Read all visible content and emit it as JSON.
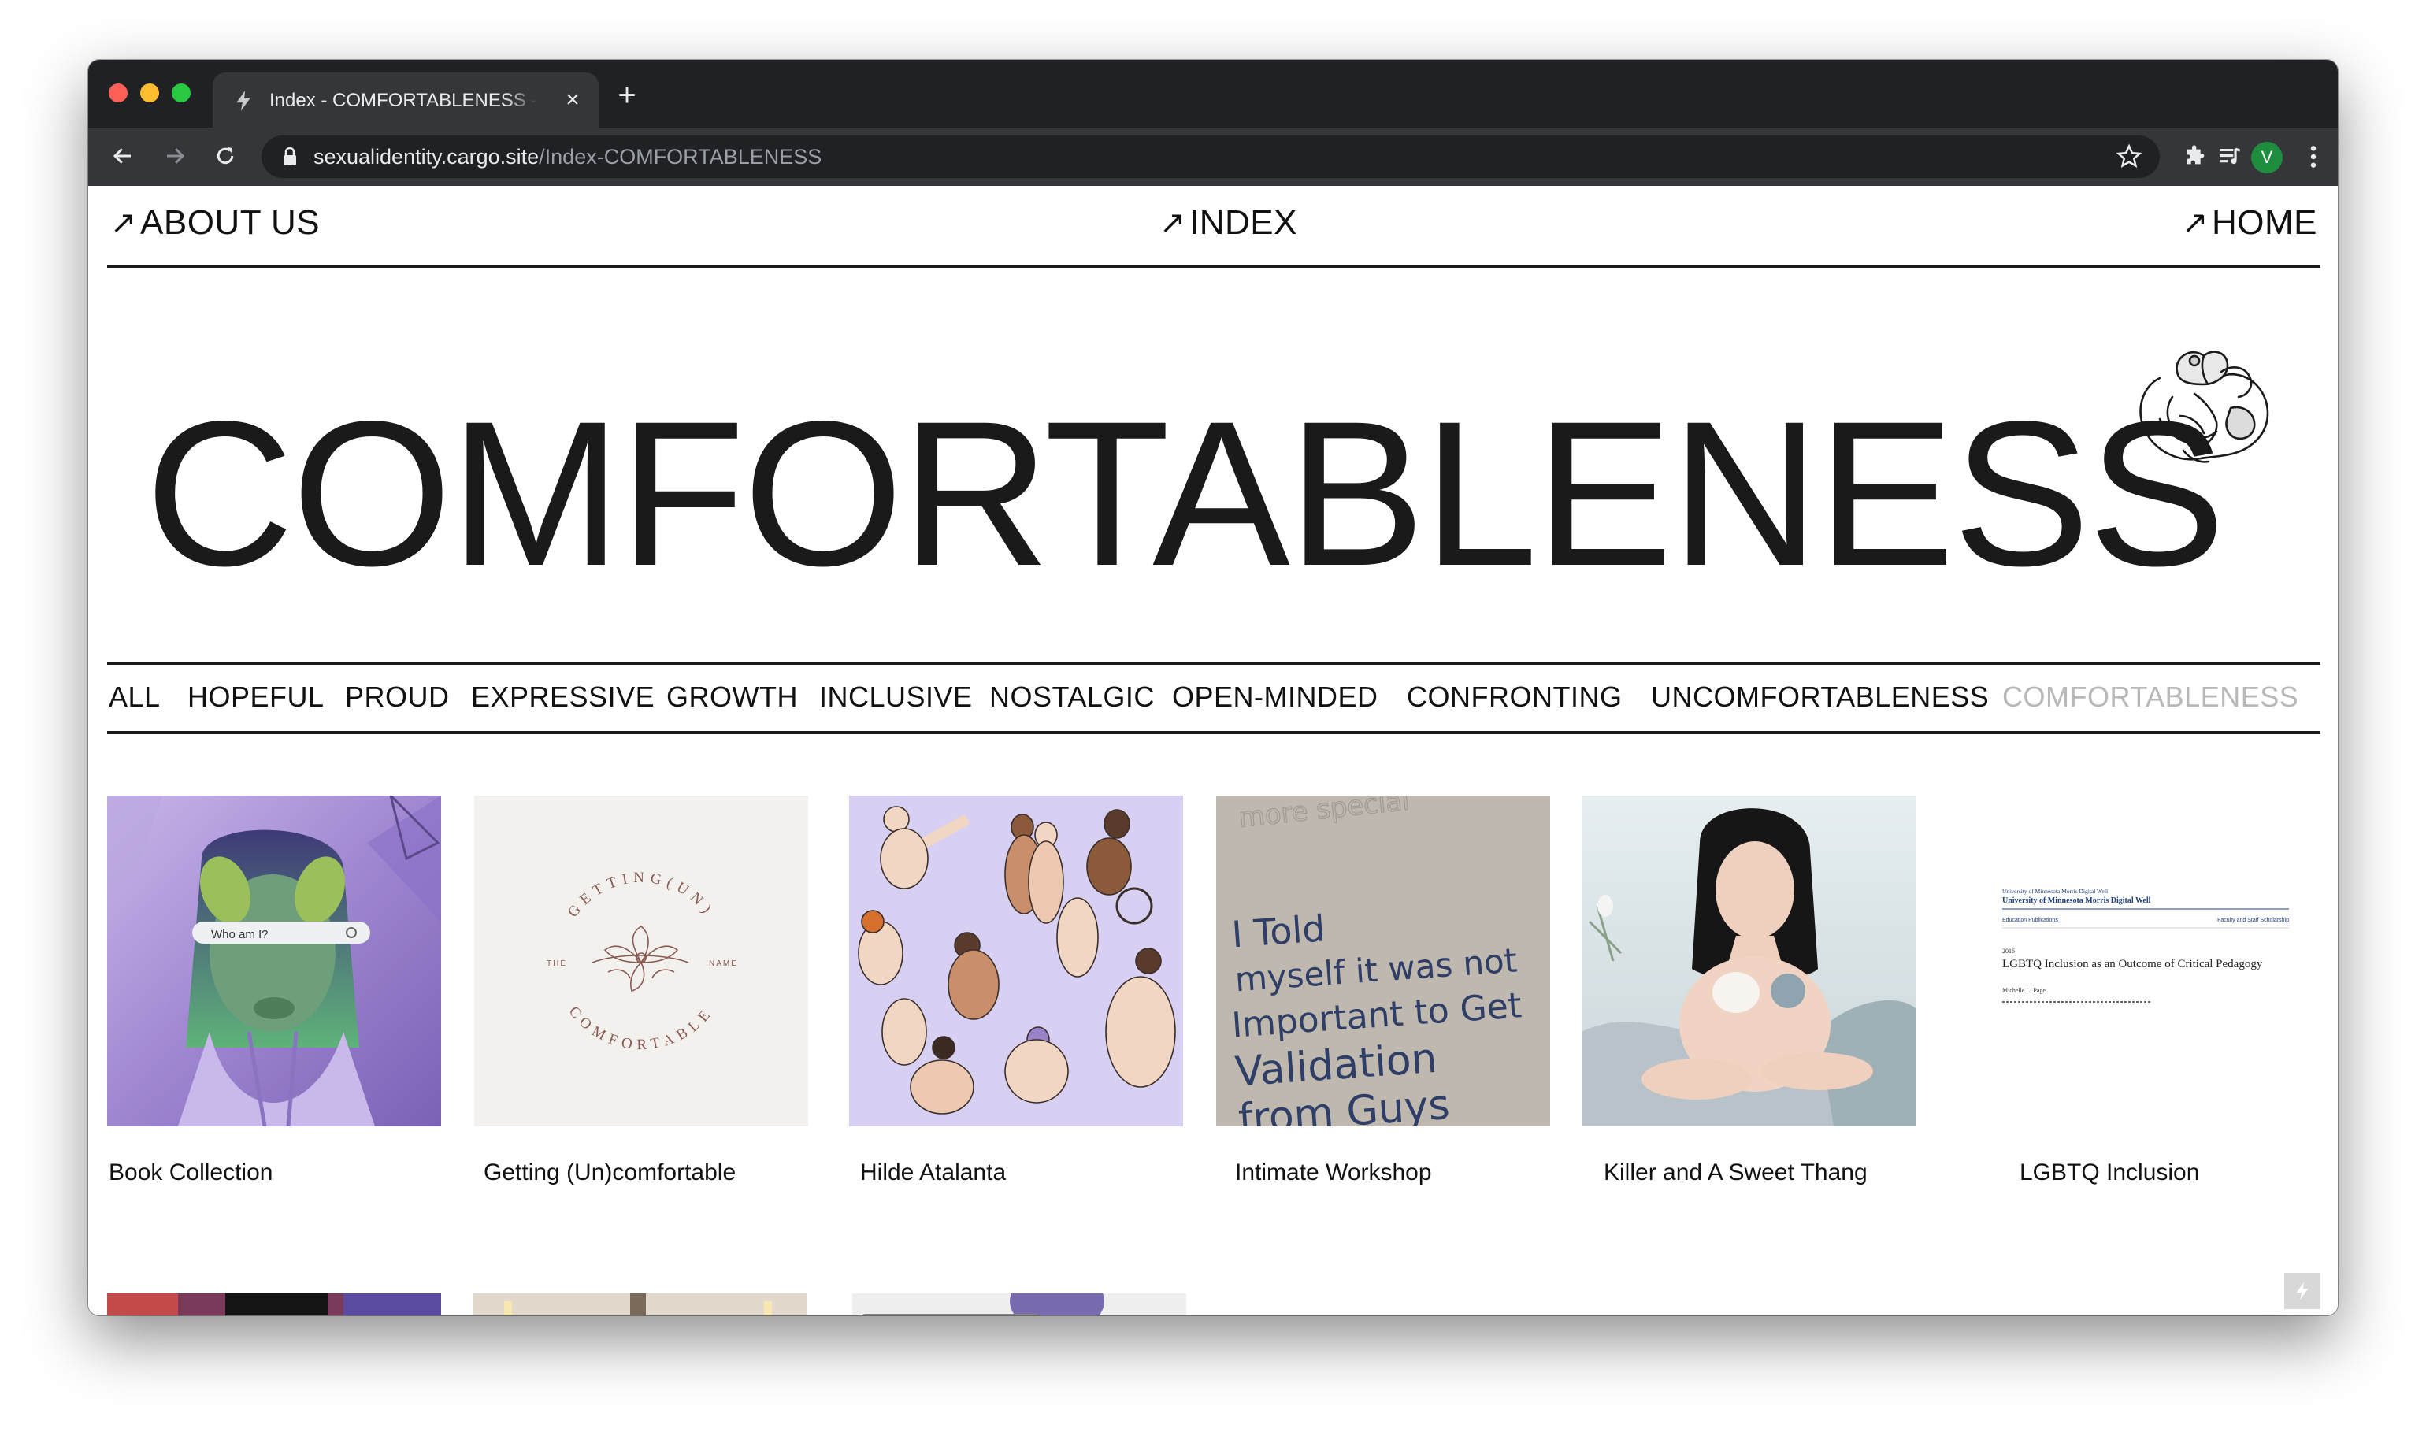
{
  "browser": {
    "tab_title": "Index - COMFORTABLENESS - ",
    "url_domain": "sexualidentity.cargo.site",
    "url_path": "/Index-COMFORTABLENESS",
    "profile_initial": "V",
    "colors": {
      "tabstrip": "#202124",
      "toolbar": "#35363a",
      "profile": "#1e8e3e"
    }
  },
  "nav": {
    "about": "ABOUT US",
    "index": "INDEX",
    "home": "HOME",
    "arrow": "↗"
  },
  "hero": {
    "title": "COMFORTABLENESS",
    "logo_icon": "hug-illustration-icon"
  },
  "filters": [
    "ALL",
    "HOPEFUL",
    "PROUD",
    "EXPRESSIVE",
    "GROWTH",
    "INCLUSIVE",
    "NOSTALGIC",
    "OPEN-MINDED",
    "CONFRONTING",
    "UNCOMFORTABLENESS",
    "COMFORTABLENESS"
  ],
  "active_filter": "COMFORTABLENESS",
  "gallery": [
    {
      "caption": "Book Collection",
      "overlay_text": "Who am I?"
    },
    {
      "caption": "Getting (Un)comfortable",
      "arc_top": "GETTING(UN)",
      "arc_bottom": "COMFORTABLE",
      "side_left": "THE",
      "side_right": "NAME"
    },
    {
      "caption": "Hilde Atalanta"
    },
    {
      "caption": "Intimate Workshop",
      "text_lines": [
        "I Told",
        "myself it was not",
        "Important to Get",
        "Validation",
        "from Guys"
      ],
      "faint_text": "more special"
    },
    {
      "caption": "Killer and A Sweet Thang"
    },
    {
      "caption": "LGBTQ Inclusion",
      "doc_header_small": "University of Minnesota Morris Digital Well",
      "doc_header": "University of Minnesota Morris Digital Well",
      "doc_left": "Education Publications",
      "doc_right": "Faculty and Staff Scholarship",
      "doc_year": "2016",
      "doc_title": "LGBTQ Inclusion as an Outcome of Critical Pedagogy",
      "doc_author": "Michelle L. Page"
    }
  ]
}
